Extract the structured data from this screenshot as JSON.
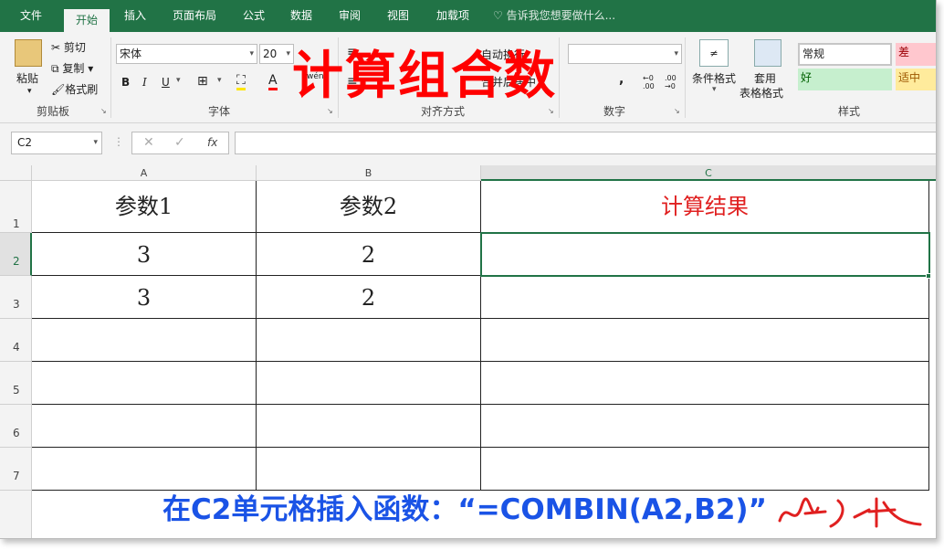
{
  "tabs": [
    "文件",
    "开始",
    "插入",
    "页面布局",
    "公式",
    "数据",
    "审阅",
    "视图",
    "加载项"
  ],
  "tell_me": "告诉我您想要做什么...",
  "clipboard": {
    "paste": "粘贴",
    "cut": "剪切",
    "copy": "复制",
    "format_painter": "格式刷",
    "label": "剪贴板"
  },
  "font": {
    "name": "宋体",
    "size": "20",
    "label": "字体",
    "bold": "B",
    "italic": "I",
    "underline": "U",
    "wen": "wén"
  },
  "alignment": {
    "wrap": "自动换行",
    "merge": "合并后居中",
    "label": "对齐方式"
  },
  "number": {
    "label": "数字",
    "format": ""
  },
  "styles": {
    "conditional": "条件格式",
    "table_line1": "套用",
    "table_line2": "表格格式",
    "normal": "常规",
    "bad": "差",
    "good": "好",
    "neutral": "适中",
    "label": "样式"
  },
  "name_box": "C2",
  "formula_value": "",
  "columns": [
    "A",
    "B",
    "C"
  ],
  "rows": [
    "1",
    "2",
    "3",
    "4",
    "5",
    "6",
    "7"
  ],
  "cells": {
    "a1": "参数1",
    "b1": "参数2",
    "c1": "计算结果",
    "a2": "3",
    "b2": "2",
    "a3": "3",
    "b3": "2"
  },
  "overlay_title": "计算组合数",
  "bottom_note": "在C2单元格插入函数：“=COMBIN(A2,B2)”",
  "colors": {
    "excel_green": "#217346",
    "title_red": "#ff0000",
    "note_blue": "#1a53e6",
    "header_red": "#e02020"
  }
}
